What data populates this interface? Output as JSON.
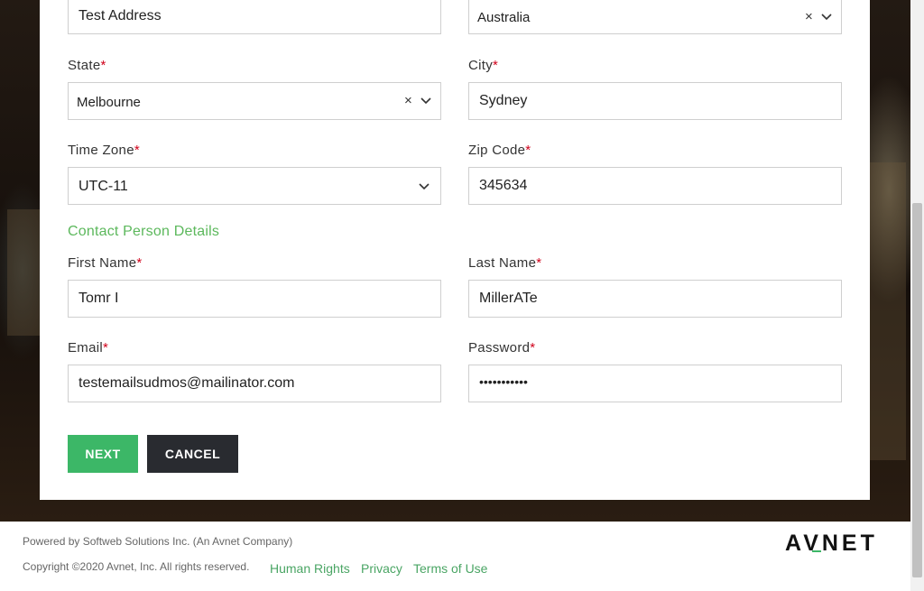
{
  "form": {
    "address": {
      "value": "Test Address"
    },
    "country": {
      "value": "Australia",
      "clear": "×"
    },
    "state": {
      "label": "State",
      "value": "Melbourne",
      "clear": "×"
    },
    "city": {
      "label": "City",
      "value": "Sydney"
    },
    "timezone": {
      "label": "Time Zone",
      "value": "UTC-11"
    },
    "zip": {
      "label": "Zip Code",
      "value": "345634"
    },
    "section_title": "Contact Person Details",
    "first_name": {
      "label": "First Name",
      "value": "Tomr I"
    },
    "last_name": {
      "label": "Last Name",
      "value": "MillerATe"
    },
    "email": {
      "label": "Email",
      "value": "testemailsudmos@mailinator.com"
    },
    "password": {
      "label": "Password",
      "value": "•••••••••••"
    },
    "required_mark": "*"
  },
  "buttons": {
    "next": "NEXT",
    "cancel": "CANCEL"
  },
  "footer": {
    "powered_by": "Powered by Softweb Solutions Inc. (An Avnet Company)",
    "copyright": "Copyright ©2020 Avnet, Inc. All rights reserved.",
    "links": [
      "Human Rights",
      "Privacy",
      "Terms of Use"
    ],
    "logo": "AVNET"
  },
  "colors": {
    "accent": "#3cb767",
    "required": "#d0021b",
    "dark_button": "#292b30"
  }
}
